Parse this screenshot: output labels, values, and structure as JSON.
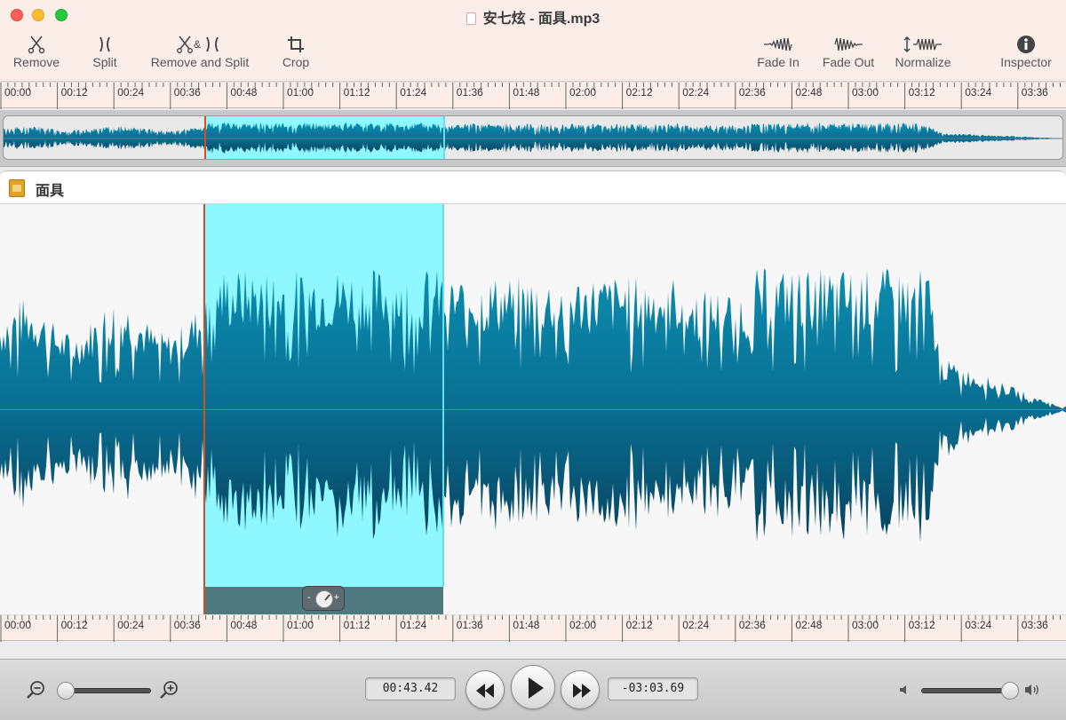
{
  "window": {
    "title": "安七炫 - 面具.mp3"
  },
  "toolbar": {
    "remove": "Remove",
    "split": "Split",
    "remove_and_split": "Remove and Split",
    "crop": "Crop",
    "fade_in": "Fade In",
    "fade_out": "Fade Out",
    "normalize": "Normalize",
    "inspector": "Inspector"
  },
  "ruler": {
    "labels": [
      "00:00",
      "00:12",
      "00:24",
      "00:36",
      "00:48",
      "01:00",
      "01:12",
      "01:24",
      "01:36",
      "01:48",
      "02:00",
      "02:12",
      "02:24",
      "02:36",
      "02:48",
      "03:00",
      "03:12",
      "03:24",
      "03:36"
    ]
  },
  "track": {
    "name": "面具",
    "volume_knob": {
      "minus": "-",
      "plus": "+"
    }
  },
  "transport": {
    "current_time": "00:43.42",
    "remaining_time": "-03:03.69",
    "zoom_level": 0.0,
    "volume_level": 0.95
  },
  "colors": {
    "waveform": "#0a6a8c",
    "selection": "#8ff7ff",
    "playhead": "#d94c1e",
    "titlebar": "#fbeee8"
  },
  "icons": {
    "remove": "scissors-icon",
    "split": "split-icon",
    "remove_and_split": "scissors-split-icon",
    "crop": "crop-icon",
    "fade_in": "fade-in-icon",
    "fade_out": "fade-out-icon",
    "normalize": "normalize-icon",
    "inspector": "info-icon"
  }
}
